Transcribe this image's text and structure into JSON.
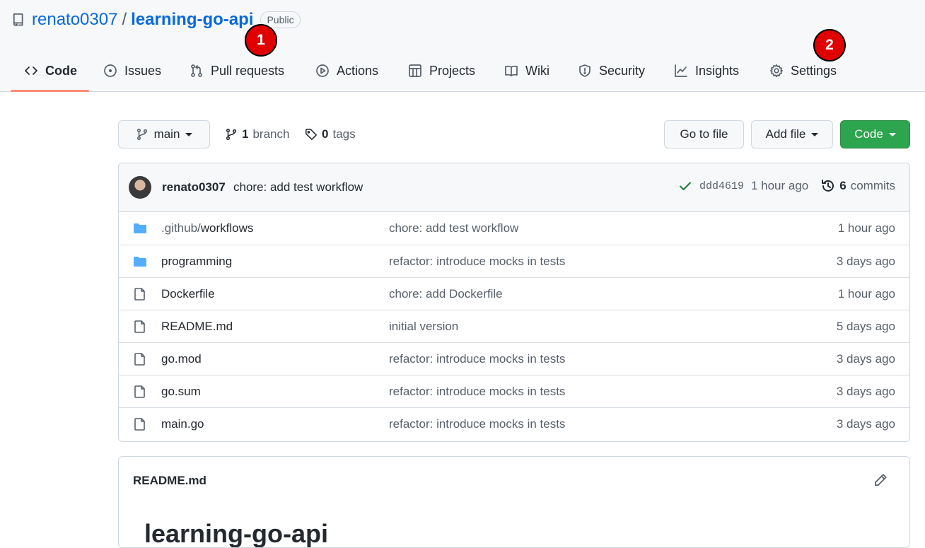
{
  "repo": {
    "owner": "renato0307",
    "separator": "/",
    "name": "learning-go-api",
    "visibility": "Public"
  },
  "markers": [
    "1",
    "2"
  ],
  "tabs": [
    {
      "label": "Code",
      "icon": "code-icon",
      "selected": true
    },
    {
      "label": "Issues",
      "icon": "issue-icon"
    },
    {
      "label": "Pull requests",
      "icon": "pull-request-icon"
    },
    {
      "label": "Actions",
      "icon": "play-icon"
    },
    {
      "label": "Projects",
      "icon": "table-icon"
    },
    {
      "label": "Wiki",
      "icon": "book-icon"
    },
    {
      "label": "Security",
      "icon": "shield-icon"
    },
    {
      "label": "Insights",
      "icon": "graph-icon"
    },
    {
      "label": "Settings",
      "icon": "gear-icon"
    }
  ],
  "toolbar": {
    "branch": "main",
    "branch_count": "1",
    "branch_label": "branch",
    "tag_count": "0",
    "tag_label": "tags",
    "go_to_file": "Go to file",
    "add_file": "Add file",
    "code": "Code"
  },
  "latest_commit": {
    "author": "renato0307",
    "message": "chore: add test workflow",
    "sha": "ddd4619",
    "time": "1 hour ago",
    "commit_count": "6",
    "commit_label": "commits",
    "status_color": "#1a7f37"
  },
  "files": [
    {
      "type": "folder",
      "name_prefix": ".github/",
      "name": "workflows",
      "commit": "chore: add test workflow",
      "age": "1 hour ago"
    },
    {
      "type": "folder",
      "name_prefix": "",
      "name": "programming",
      "commit": "refactor: introduce mocks in tests",
      "age": "3 days ago"
    },
    {
      "type": "file",
      "name_prefix": "",
      "name": "Dockerfile",
      "commit": "chore: add Dockerfile",
      "age": "1 hour ago"
    },
    {
      "type": "file",
      "name_prefix": "",
      "name": "README.md",
      "commit": "initial version",
      "age": "5 days ago"
    },
    {
      "type": "file",
      "name_prefix": "",
      "name": "go.mod",
      "commit": "refactor: introduce mocks in tests",
      "age": "3 days ago"
    },
    {
      "type": "file",
      "name_prefix": "",
      "name": "go.sum",
      "commit": "refactor: introduce mocks in tests",
      "age": "3 days ago"
    },
    {
      "type": "file",
      "name_prefix": "",
      "name": "main.go",
      "commit": "refactor: introduce mocks in tests",
      "age": "3 days ago"
    }
  ],
  "readme": {
    "title": "README.md",
    "heading": "learning-go-api"
  },
  "colors": {
    "link": "#0969da",
    "primary_button": "#2da44e",
    "folder": "#54aeff",
    "selected_tab_underline": "#fd8c73",
    "marker": "#e00000"
  }
}
